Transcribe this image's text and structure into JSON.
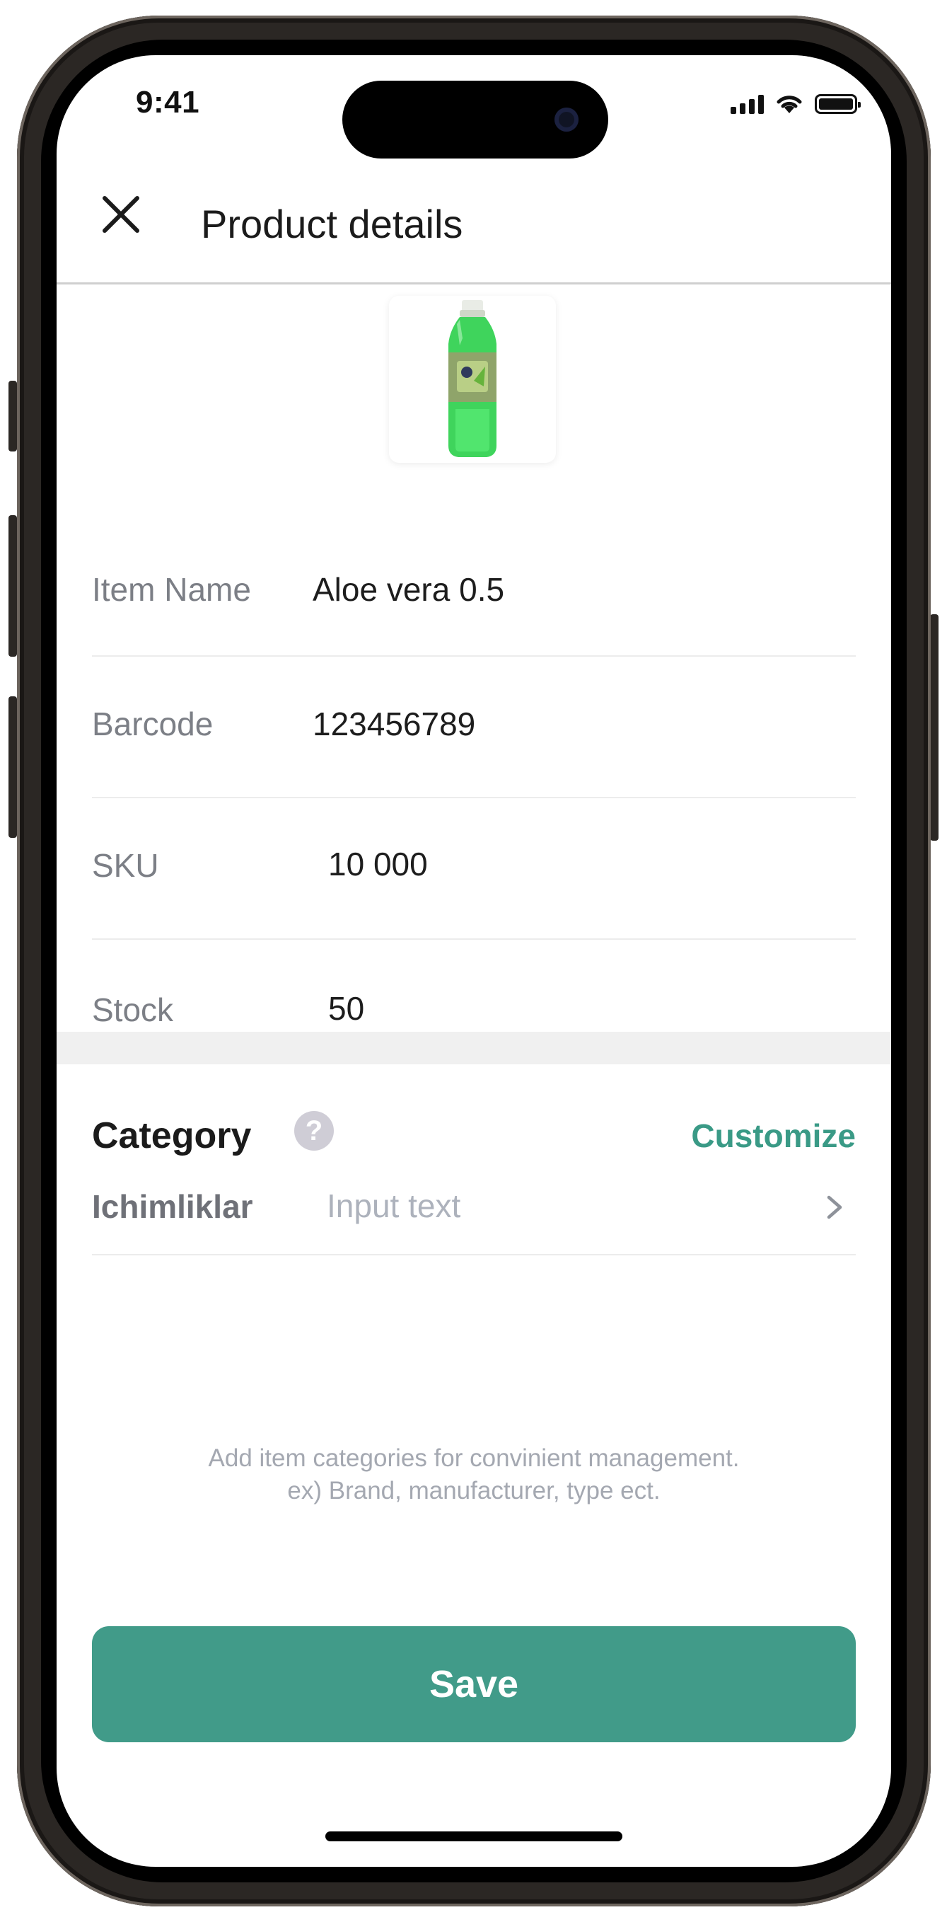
{
  "status_bar": {
    "time": "9:41",
    "icons": [
      "cellular-signal-icon",
      "wifi-icon",
      "battery-icon"
    ]
  },
  "header": {
    "close_icon": "close-icon",
    "title": "Product details"
  },
  "product": {
    "image_icon": "green-bottle-icon",
    "fields": [
      {
        "label": "Item Name",
        "value": "Aloe vera 0.5"
      },
      {
        "label": "Barcode",
        "value": "123456789"
      },
      {
        "label": "SKU",
        "value": "10 000"
      },
      {
        "label": "Stock",
        "value": "50"
      }
    ]
  },
  "category": {
    "title": "Category",
    "help_icon": "question-mark-icon",
    "help_glyph": "?",
    "customize_label": "Customize",
    "name": "Ichimliklar",
    "input_placeholder": "Input text",
    "input_value": "",
    "chevron_icon": "chevron-right-icon",
    "hint_line1": "Add item categories for convinient management.",
    "hint_line2": "ex) Brand, manufacturer, type ect."
  },
  "actions": {
    "save_label": "Save"
  },
  "colors": {
    "accent": "#419b89",
    "accent_text": "#3a9a86",
    "label_gray": "#7c7f86",
    "divider": "#ececec"
  }
}
